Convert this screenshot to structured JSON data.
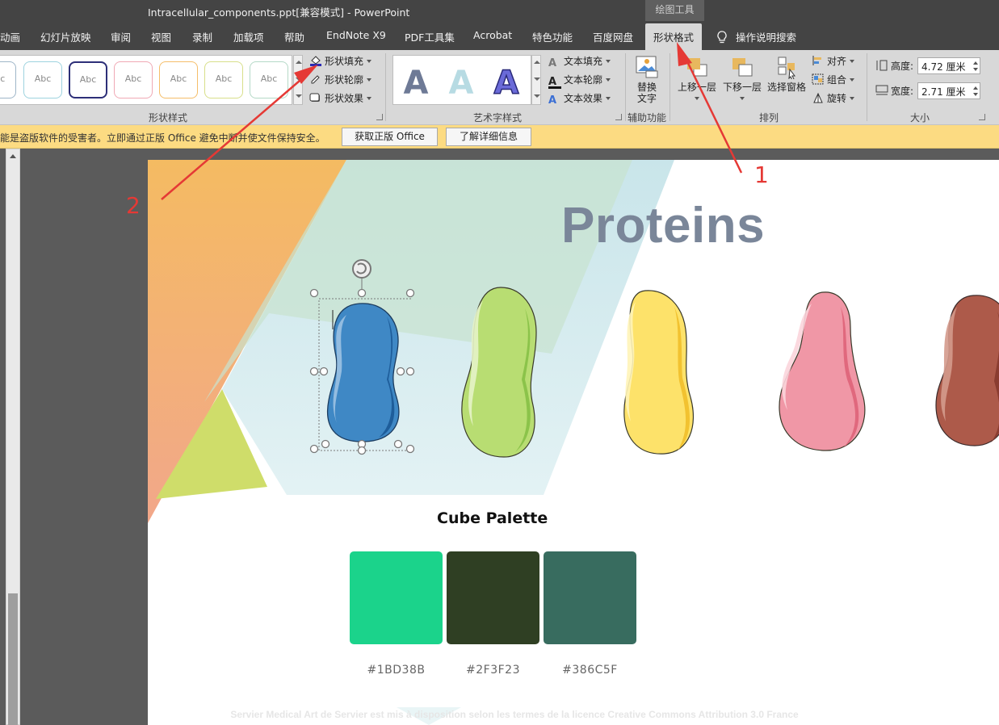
{
  "window": {
    "title": "Intracellular_components.ppt[兼容模式]  -  PowerPoint",
    "contextual_tab_group": "绘图工具"
  },
  "tabs": [
    {
      "label": "动画"
    },
    {
      "label": "幻灯片放映"
    },
    {
      "label": "审阅"
    },
    {
      "label": "视图"
    },
    {
      "label": "录制"
    },
    {
      "label": "加载项"
    },
    {
      "label": "帮助"
    },
    {
      "label": "EndNote X9"
    },
    {
      "label": "PDF工具集"
    },
    {
      "label": "Acrobat"
    },
    {
      "label": "特色功能"
    },
    {
      "label": "百度网盘"
    },
    {
      "label": "形状格式",
      "active": true
    }
  ],
  "tell_me": "操作说明搜索",
  "ribbon": {
    "shape_styles": {
      "label": "形状样式",
      "swatch_text": "Abc",
      "shape_fill": "形状填充",
      "shape_outline": "形状轮廓",
      "shape_effects": "形状效果"
    },
    "wordart_styles": {
      "label": "艺术字样式",
      "letter": "A",
      "text_fill": "文本填充",
      "text_outline": "文本轮廓",
      "text_effects": "文本效果"
    },
    "accessibility": {
      "label": "辅助功能",
      "alt_text_line1": "替换",
      "alt_text_line2": "文字"
    },
    "arrange": {
      "label": "排列",
      "bring_forward": "上移一层",
      "send_backward": "下移一层",
      "selection_pane": "选择窗格",
      "align": "对齐",
      "group": "组合",
      "rotate": "旋转"
    },
    "size": {
      "label": "大小",
      "height_label": "高度:",
      "height_value": "4.72 厘米",
      "width_label": "宽度:",
      "width_value": "2.71 厘米"
    }
  },
  "notice": {
    "message": "能是盗版软件的受害者。立即通过正版 Office 避免中断并使文件保持安全。",
    "get_genuine": "获取正版 Office",
    "learn_more": "了解详细信息"
  },
  "slide": {
    "title": "Proteins",
    "palette_title": "Cube Palette",
    "palette": [
      {
        "hex": "#1BD38B",
        "color": "#1BD38B"
      },
      {
        "hex": "#2F3F23",
        "color": "#2F3F23"
      },
      {
        "hex": "#386C5F",
        "color": "#386C5F"
      }
    ],
    "credit": "Servier Medical Art de Servier est mis à disposition selon les termes de la licence Creative Commons Attribution 3.0 France",
    "proteins": [
      {
        "name": "blue",
        "fill": "#3f88c5",
        "dark": "#1e5d9a",
        "selected": true
      },
      {
        "name": "green",
        "fill": "#b8dd72",
        "dark": "#8bc34a"
      },
      {
        "name": "yellow",
        "fill": "#fde26a",
        "dark": "#f2c230"
      },
      {
        "name": "pink",
        "fill": "#f097a6",
        "dark": "#e0687d"
      },
      {
        "name": "brown",
        "fill": "#ad5a4a",
        "dark": "#8a3c30"
      }
    ]
  },
  "annotations": [
    {
      "number": "1"
    },
    {
      "number": "2"
    }
  ],
  "colors": {
    "title_bar": "#444444",
    "ribbon": "#d8d8d8",
    "notice_bar": "#fcdb82",
    "annotation": "#e53935"
  }
}
